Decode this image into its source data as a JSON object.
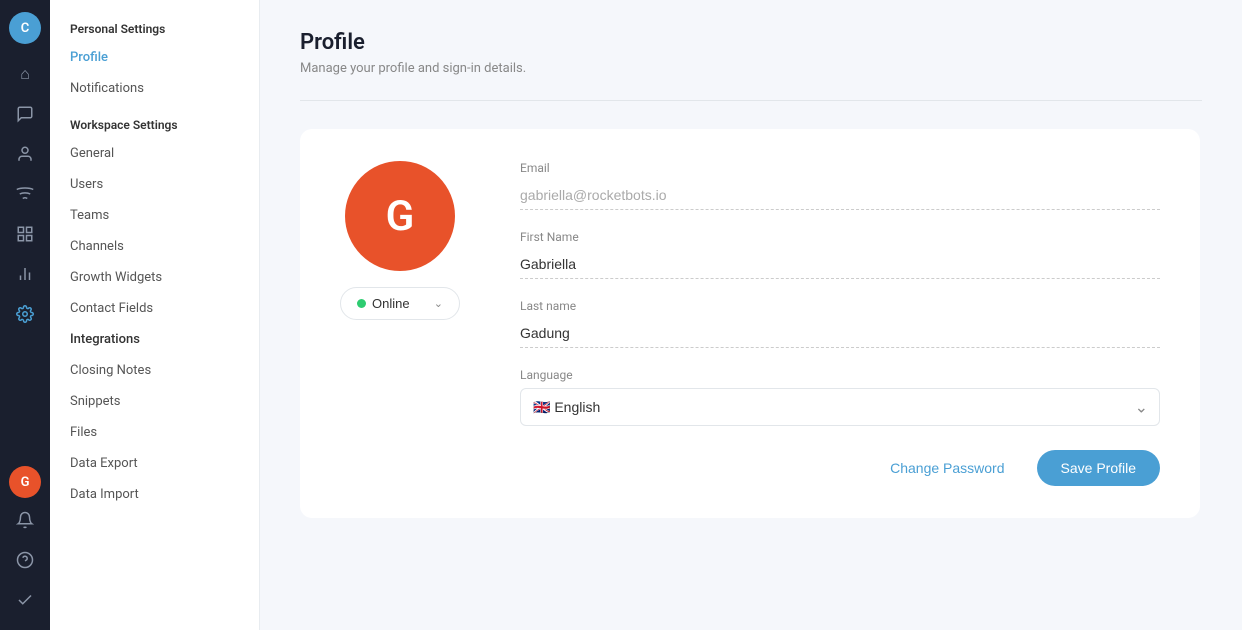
{
  "app": {
    "title": "Personal Settings"
  },
  "icon_sidebar": {
    "top_avatar_initials": "C",
    "bottom_avatar_initials": "G",
    "icons": [
      {
        "name": "home-icon",
        "symbol": "⌂"
      },
      {
        "name": "chat-icon",
        "symbol": "💬"
      },
      {
        "name": "contacts-icon",
        "symbol": "👤"
      },
      {
        "name": "signal-icon",
        "symbol": "📶"
      },
      {
        "name": "team-icon",
        "symbol": "⊞"
      },
      {
        "name": "chart-icon",
        "symbol": "📊"
      },
      {
        "name": "gear-icon",
        "symbol": "⚙"
      },
      {
        "name": "checkmark-icon",
        "symbol": "✔"
      }
    ]
  },
  "left_nav": {
    "personal_section_title": "Personal Settings",
    "profile_label": "Profile",
    "notifications_label": "Notifications",
    "workspace_section_title": "Workspace Settings",
    "workspace_items": [
      {
        "label": "General",
        "name": "general"
      },
      {
        "label": "Users",
        "name": "users"
      },
      {
        "label": "Teams",
        "name": "teams"
      },
      {
        "label": "Channels",
        "name": "channels"
      },
      {
        "label": "Growth Widgets",
        "name": "growth-widgets"
      },
      {
        "label": "Contact Fields",
        "name": "contact-fields"
      },
      {
        "label": "Integrations",
        "name": "integrations"
      },
      {
        "label": "Closing Notes",
        "name": "closing-notes"
      },
      {
        "label": "Snippets",
        "name": "snippets"
      },
      {
        "label": "Files",
        "name": "files"
      },
      {
        "label": "Data Export",
        "name": "data-export"
      },
      {
        "label": "Data Import",
        "name": "data-import"
      }
    ]
  },
  "profile_page": {
    "title": "Profile",
    "subtitle": "Manage your profile and sign-in details.",
    "avatar_initial": "G",
    "status": {
      "label": "Online",
      "dot_color": "#2ecc71"
    },
    "fields": {
      "email_label": "Email",
      "email_value": "gabriella@rocketbots.io",
      "first_name_label": "First Name",
      "first_name_value": "Gabriella",
      "last_name_label": "Last name",
      "last_name_value": "Gadung",
      "language_label": "Language",
      "language_flag": "🇬🇧",
      "language_value": "English"
    },
    "actions": {
      "change_password_label": "Change Password",
      "save_profile_label": "Save Profile"
    }
  }
}
